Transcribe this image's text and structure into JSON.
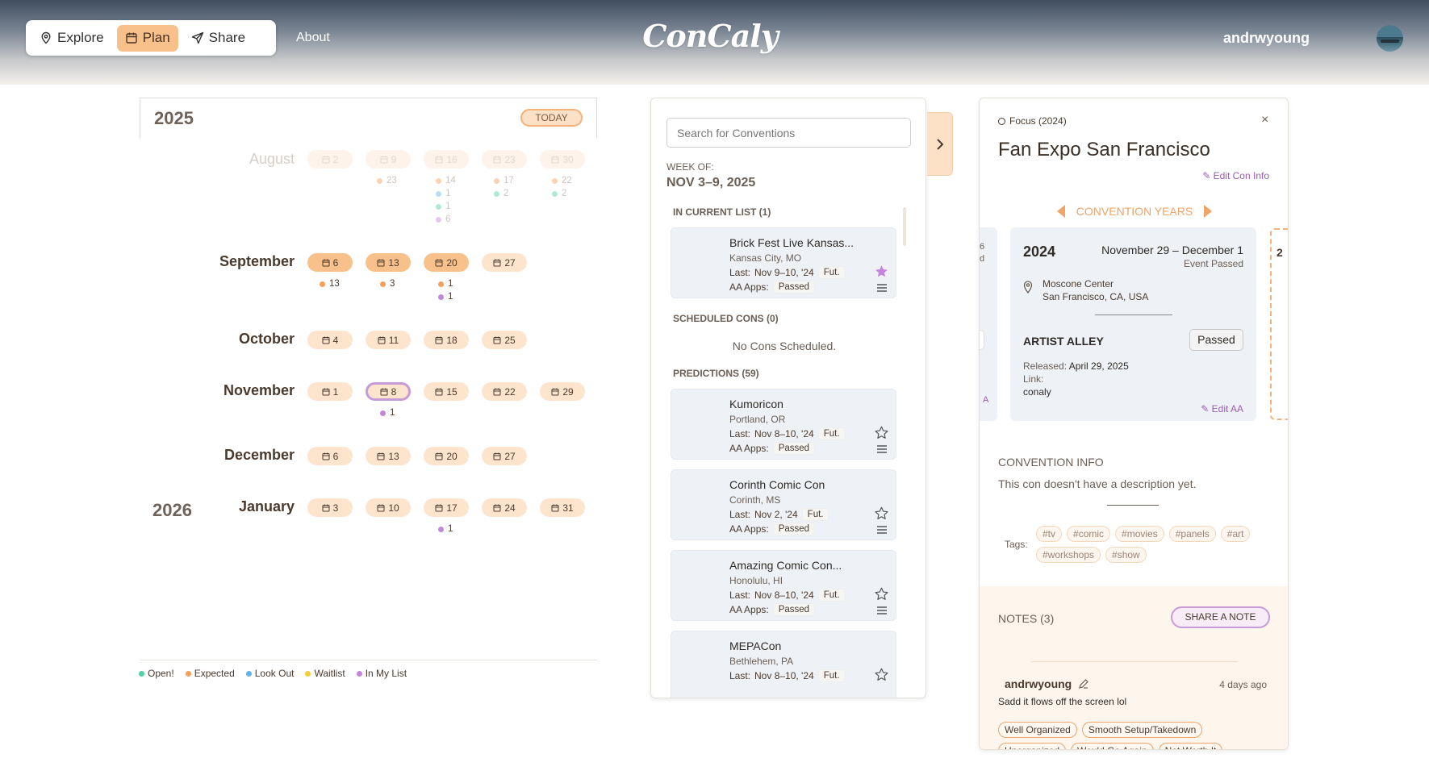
{
  "nav": {
    "explore_label": "Explore",
    "plan_label": "Plan",
    "share_label": "Share",
    "about_label": "About",
    "logo": "ConCaly",
    "username": "andrwyoung"
  },
  "calendar": {
    "year": "2025",
    "next_year": "2026",
    "today_label": "TODAY",
    "months": [
      {
        "name": "August",
        "weeks": [
          "2",
          "9",
          "16",
          "23",
          "30"
        ]
      },
      {
        "name": "September",
        "weeks": [
          "6",
          "13",
          "20",
          "27"
        ]
      },
      {
        "name": "October",
        "weeks": [
          "4",
          "11",
          "18",
          "25"
        ]
      },
      {
        "name": "November",
        "weeks": [
          "1",
          "8",
          "15",
          "22",
          "29"
        ]
      },
      {
        "name": "December",
        "weeks": [
          "6",
          "13",
          "20",
          "27"
        ]
      },
      {
        "name": "January",
        "weeks": [
          "3",
          "10",
          "17",
          "24",
          "31"
        ]
      }
    ],
    "counts": {
      "aug_9": [
        "23"
      ],
      "aug_16": [
        "14",
        "1",
        "1",
        "6"
      ],
      "aug_23": [
        "17",
        "2"
      ],
      "aug_30": [
        "22",
        "2"
      ],
      "sep_6": [
        "13"
      ],
      "sep_13": [
        "3"
      ],
      "sep_20": [
        "1",
        "1"
      ],
      "nov_8": [
        "1"
      ],
      "jan_17": [
        "1"
      ]
    },
    "legend": {
      "open": "Open!",
      "expected": "Expected",
      "lookout": "Look Out",
      "waitlist": "Waitlist",
      "inlist": "In My List"
    },
    "colors": {
      "open": "#4fd1a5",
      "expected": "#f5a05a",
      "lookout": "#66b3ec",
      "waitlist": "#f2cf3a",
      "inlist": "#c585dd"
    }
  },
  "search_panel": {
    "placeholder": "Search for Conventions",
    "week_of_label": "WEEK OF:",
    "week_range": "NOV 3–9, 2025",
    "in_list_label": "IN CURRENT LIST (1)",
    "scheduled_label": "SCHEDULED CONS (0)",
    "no_cons": "No Cons Scheduled.",
    "predictions_label": "PREDICTIONS (59)",
    "last_label": "Last:",
    "aa_label": "AA Apps:",
    "cards": [
      {
        "name": "Brick Fest Live Kansas...",
        "location": "Kansas City, MO",
        "last": "Nov 9–10, '24",
        "fut": "Fut.",
        "aa": "Passed",
        "starred": true
      },
      {
        "name": "Kumoricon",
        "location": "Portland, OR",
        "last": "Nov 8–10, '24",
        "fut": "Fut.",
        "aa": "Passed",
        "starred": false
      },
      {
        "name": "Corinth Comic Con",
        "location": "Corinth, MS",
        "last": "Nov 2, '24",
        "fut": "Fut.",
        "aa": "Passed",
        "starred": false
      },
      {
        "name": "Amazing Comic Con...",
        "location": "Honolulu, HI",
        "last": "Nov 8–10, '24",
        "fut": "Fut.",
        "aa": "Passed",
        "starred": false
      },
      {
        "name": "MEPACon",
        "location": "Bethlehem, PA",
        "last": "Nov 8–10, '24",
        "fut": "Fut.",
        "aa": "",
        "starred": false
      }
    ]
  },
  "detail": {
    "focus": "Focus (2024)",
    "close": "×",
    "title": "Fan Expo San Francisco",
    "edit_con_info": "Edit Con Info",
    "convention_years": "CONVENTION YEARS",
    "side_left_a": "6",
    "side_left_b": "d",
    "side_left_c": "A",
    "side_right": "2",
    "year": "2024",
    "dates": "November 29 – December 1",
    "event_status": "Event Passed",
    "venue": "Moscone Center",
    "venue_location": "San Francisco, CA, USA",
    "artist_alley": "ARTIST ALLEY",
    "aa_status": "Passed",
    "released_label": "Released:",
    "released_date": "April 29, 2025",
    "link_label": "Link:",
    "link_value": "conaly",
    "edit_aa": "Edit AA",
    "info_head": "CONVENTION INFO",
    "info_text": "This con doesn't have a description yet.",
    "tags_label": "Tags:",
    "tags": [
      "#tv",
      "#comic",
      "#movies",
      "#panels",
      "#art",
      "#workshops",
      "#show"
    ],
    "notes_head": "NOTES (3)",
    "share_note": "SHARE A NOTE",
    "note_user": "andrwyoung",
    "note_time": "4 days ago",
    "note_text": "Sadd it flows off the screen lol",
    "note_tags": [
      "Well Organized",
      "Smooth Setup/Takedown",
      "Unorganized",
      "Would Go Again",
      "Not Worth It"
    ]
  }
}
